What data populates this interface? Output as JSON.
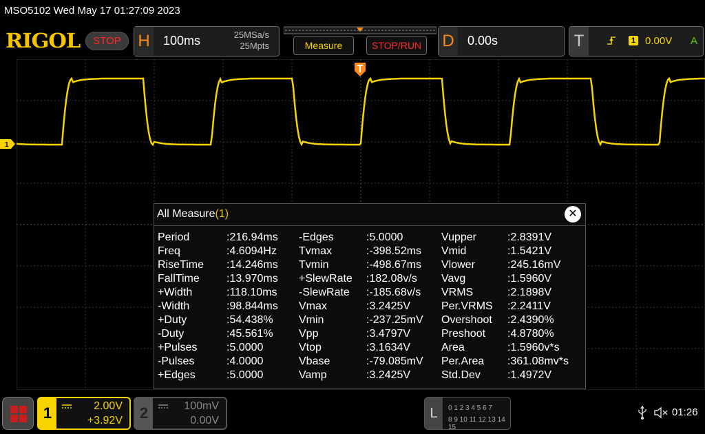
{
  "status": {
    "datetime_text": "MSO5102  Wed May 17 01:27:09 2023"
  },
  "brand": {
    "logo": "RIGOL",
    "run_state": "STOP"
  },
  "horizontal": {
    "letter": "H",
    "timebase": "100ms",
    "sample_rate": "25MSa/s",
    "memory_depth": "25Mpts"
  },
  "buttons": {
    "measure": "Measure",
    "stop_run": "STOP/RUN"
  },
  "delay": {
    "letter": "D",
    "value": "0.00s"
  },
  "trigger": {
    "letter": "T",
    "source": "1",
    "level": "0.00V",
    "mode": "A"
  },
  "markers": {
    "ch1": "1"
  },
  "measure_panel": {
    "title": "All Measure",
    "index": "(1)",
    "close_glyph": "✕",
    "columns": [
      [
        {
          "name": "Period",
          "value": ":216.94ms"
        },
        {
          "name": "Freq",
          "value": ":4.6094Hz"
        },
        {
          "name": "RiseTime",
          "value": ":14.246ms"
        },
        {
          "name": "FallTime",
          "value": ":13.970ms"
        },
        {
          "name": "+Width",
          "value": ":118.10ms"
        },
        {
          "name": "-Width",
          "value": ":98.844ms"
        },
        {
          "name": "+Duty",
          "value": ":54.438%"
        },
        {
          "name": "-Duty",
          "value": ":45.561%"
        },
        {
          "name": "+Pulses",
          "value": ":5.0000"
        },
        {
          "name": "-Pulses",
          "value": ":4.0000"
        },
        {
          "name": "+Edges",
          "value": ":5.0000"
        }
      ],
      [
        {
          "name": "-Edges",
          "value": ":5.0000"
        },
        {
          "name": "Tvmax",
          "value": ":-398.52ms"
        },
        {
          "name": "Tvmin",
          "value": ":-498.67ms"
        },
        {
          "name": "+SlewRate",
          "value": ":182.08v/s"
        },
        {
          "name": "-SlewRate",
          "value": ":-185.68v/s"
        },
        {
          "name": "Vmax",
          "value": ":3.2425V"
        },
        {
          "name": "Vmin",
          "value": ":-237.25mV"
        },
        {
          "name": "Vpp",
          "value": ":3.4797V"
        },
        {
          "name": "Vtop",
          "value": ":3.1634V"
        },
        {
          "name": "Vbase",
          "value": ":-79.085mV"
        },
        {
          "name": "Vamp",
          "value": ":3.2425V"
        }
      ],
      [
        {
          "name": "Vupper",
          "value": ":2.8391V"
        },
        {
          "name": "Vmid",
          "value": ":1.5421V"
        },
        {
          "name": "Vlower",
          "value": ":245.16mV"
        },
        {
          "name": "Vavg",
          "value": ":1.5960V"
        },
        {
          "name": "VRMS",
          "value": ":2.1898V"
        },
        {
          "name": "Per.VRMS",
          "value": ":2.2411V"
        },
        {
          "name": "Overshoot",
          "value": ":2.4390%"
        },
        {
          "name": "Preshoot",
          "value": ":4.8780%"
        },
        {
          "name": "Area",
          "value": ":1.5960v*s"
        },
        {
          "name": "Per.Area",
          "value": ":361.08mv*s"
        },
        {
          "name": "Std.Dev",
          "value": ":1.4972V"
        }
      ]
    ]
  },
  "channels": {
    "ch1": {
      "number": "1",
      "scale": "2.00V",
      "offset": "+3.92V",
      "color": "#f5d400"
    },
    "ch2": {
      "number": "2",
      "scale": "100mV",
      "offset": "0.00V",
      "color": "#888888"
    }
  },
  "logic": {
    "letter": "L",
    "row1": "0 1 2 3   4 5 6 7",
    "row2": "8  9 10 11  12 13 14 15"
  },
  "system": {
    "time": "01:26"
  },
  "waveform": {
    "color": "#f5d400",
    "period_ms": 216.94,
    "duty_percent": 54.438,
    "rise_ms": 14.246,
    "fall_ms": 13.97
  },
  "icons": [
    "stop-indicator",
    "trigger-edge-icon",
    "home-menu-icon",
    "usb-icon",
    "speaker-muted-icon",
    "close-icon"
  ]
}
